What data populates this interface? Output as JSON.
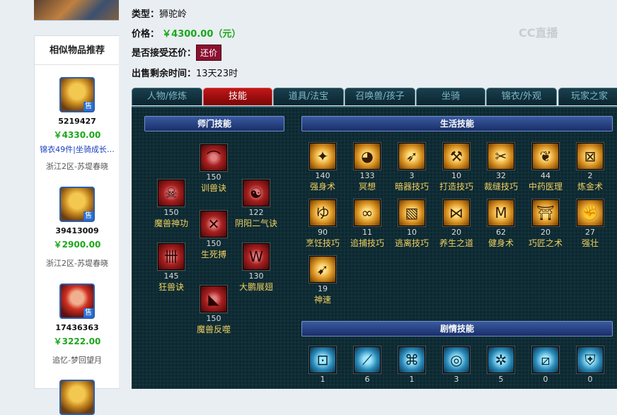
{
  "recommend": {
    "title": "相似物品推荐",
    "items": [
      {
        "id": "5219427",
        "price": "￥4330.00",
        "desc": "锦衣49件|坐骑成长…",
        "server": "浙江2区-苏堤春晓",
        "sale": "售",
        "thumb": "lion-pet-icon"
      },
      {
        "id": "39413009",
        "price": "￥2900.00",
        "desc": "",
        "server": "浙江2区-苏堤春晓",
        "sale": "售",
        "thumb": "lion-pet-icon"
      },
      {
        "id": "17436363",
        "price": "￥3222.00",
        "desc": "",
        "server": "追忆-梦回望月",
        "sale": "售",
        "thumb": "red-hair-character-icon"
      }
    ]
  },
  "info": {
    "type_label": "类型：",
    "type_value": "狮驼岭",
    "price_label": "价格：",
    "price_value": "￥4300.00（元）",
    "counter_label": "是否接受还价：",
    "counter_button": "还价",
    "time_label": "出售剩余时间：",
    "time_value": "13天23时"
  },
  "watermark": "CC直播",
  "tabs": [
    {
      "label": "人物/修炼",
      "active": false
    },
    {
      "label": "技能",
      "active": true
    },
    {
      "label": "道具/法宝",
      "active": false
    },
    {
      "label": "召唤兽/孩子",
      "active": false
    },
    {
      "label": "坐骑",
      "active": false
    },
    {
      "label": "锦衣/外观",
      "active": false
    },
    {
      "label": "玩家之家",
      "active": false
    }
  ],
  "sections": {
    "school": "师门技能",
    "life": "生活技能",
    "story": "剧情技能"
  },
  "school_skills": [
    {
      "level": "150",
      "name": "训兽诀",
      "icon": "whip-icon"
    },
    {
      "level": "150",
      "name": "魔兽神功",
      "icon": "demon-mask-icon"
    },
    {
      "level": "122",
      "name": "阴阳二气诀",
      "icon": "yin-yang-icon"
    },
    {
      "level": "150",
      "name": "生死搏",
      "icon": "crossed-blades-icon"
    },
    {
      "level": "145",
      "name": "狂兽诀",
      "icon": "beast-claw-icon"
    },
    {
      "level": "130",
      "name": "大鹏展翅",
      "icon": "wings-icon"
    },
    {
      "level": "150",
      "name": "魔兽反噬",
      "icon": "beast-bite-icon"
    }
  ],
  "life_skills": [
    {
      "level": "140",
      "name": "强身术",
      "icon": "strength-icon"
    },
    {
      "level": "133",
      "name": "冥想",
      "icon": "meditate-icon"
    },
    {
      "level": "3",
      "name": "暗器技巧",
      "icon": "dart-icon"
    },
    {
      "level": "10",
      "name": "打造技巧",
      "icon": "hammer-icon"
    },
    {
      "level": "32",
      "name": "裁缝技巧",
      "icon": "scissors-icon"
    },
    {
      "level": "44",
      "name": "中药医理",
      "icon": "herb-icon"
    },
    {
      "level": "2",
      "name": "炼金术",
      "icon": "alchemy-icon"
    },
    {
      "level": "90",
      "name": "烹饪技巧",
      "icon": "cooking-icon"
    },
    {
      "level": "11",
      "name": "追捕技巧",
      "icon": "chain-icon"
    },
    {
      "level": "10",
      "name": "逃离技巧",
      "icon": "escape-icon"
    },
    {
      "level": "20",
      "name": "养生之道",
      "icon": "health-icon"
    },
    {
      "level": "62",
      "name": "健身术",
      "icon": "fitness-icon"
    },
    {
      "level": "20",
      "name": "巧匠之术",
      "icon": "craftsman-icon"
    },
    {
      "level": "27",
      "name": "强壮",
      "icon": "muscle-icon"
    },
    {
      "level": "19",
      "name": "神速",
      "icon": "speed-icon"
    }
  ],
  "story_skills": [
    {
      "level": "1",
      "icon": "story-skill-icon-1"
    },
    {
      "level": "6",
      "icon": "story-skill-icon-2"
    },
    {
      "level": "1",
      "icon": "story-skill-icon-3"
    },
    {
      "level": "3",
      "icon": "story-skill-icon-4"
    },
    {
      "level": "5",
      "icon": "story-skill-icon-5"
    },
    {
      "level": "0",
      "icon": "story-skill-icon-6"
    },
    {
      "level": "0",
      "icon": "story-skill-icon-7"
    }
  ],
  "colors": {
    "price_green": "#1aa81a",
    "active_tab_red": "#c01818",
    "counter_button": "#8b1030",
    "panel_bg": "#0b2830",
    "skill_name_gold": "#f0d060"
  }
}
